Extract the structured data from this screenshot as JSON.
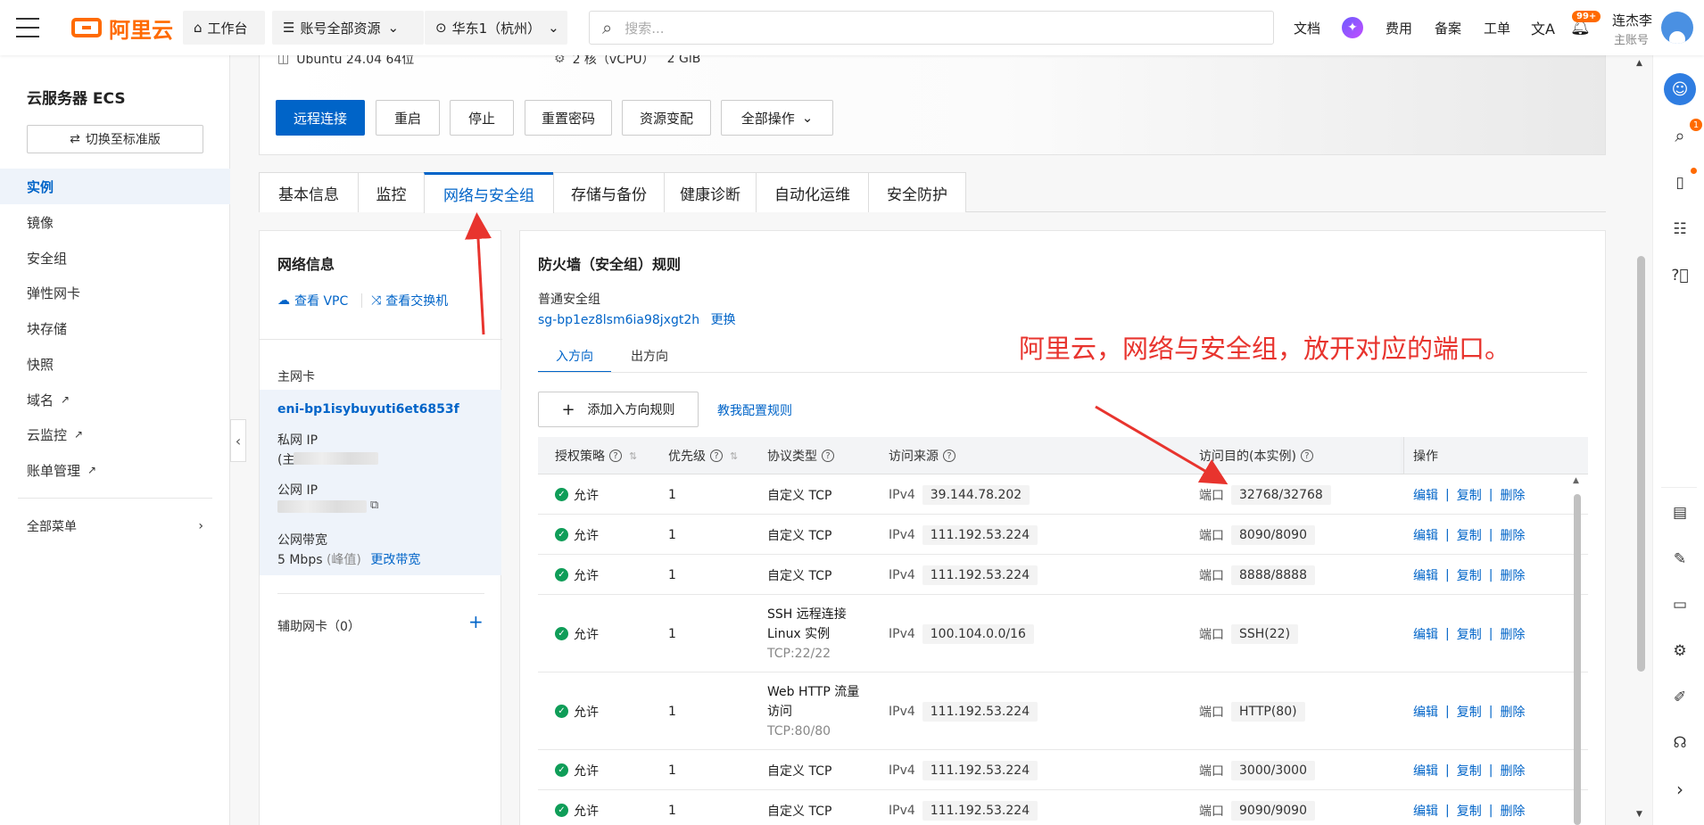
{
  "topbar": {
    "logo_text": "阿里云",
    "workbench": "工作台",
    "resources": "账号全部资源",
    "region": "华东1（杭州）",
    "search_placeholder": "搜索...",
    "docs": "文档",
    "billing": "费用",
    "icp": "备案",
    "ticket": "工单",
    "notif_badge": "99+",
    "user_name": "连杰李",
    "user_role": "主账号"
  },
  "sidebar": {
    "title": "云服务器 ECS",
    "switch_btn": "切换至标准版",
    "items": [
      {
        "label": "实例"
      },
      {
        "label": "镜像"
      },
      {
        "label": "安全组"
      },
      {
        "label": "弹性网卡"
      },
      {
        "label": "块存储"
      },
      {
        "label": "快照"
      },
      {
        "label": "域名"
      },
      {
        "label": "云监控"
      },
      {
        "label": "账单管理"
      }
    ],
    "all_menu": "全部菜单"
  },
  "instance": {
    "os": "Ubuntu 24.04 64位",
    "spec_cpu": "2 核（vCPU）",
    "spec_mem": "2 GiB",
    "buttons": {
      "remote": "远程连接",
      "restart": "重启",
      "stop": "停止",
      "reset_pwd": "重置密码",
      "resize": "资源变配",
      "all_ops": "全部操作"
    }
  },
  "tabs": [
    "基本信息",
    "监控",
    "网络与安全组",
    "存储与备份",
    "健康诊断",
    "自动化运维",
    "安全防护"
  ],
  "network": {
    "title": "网络信息",
    "view_vpc": "查看 VPC",
    "view_switch": "查看交换机",
    "primary_nic_label": "主网卡",
    "nic_id": "eni-bp1isybuyuti6et6853f",
    "private_ip_label": "私网 IP",
    "private_ip_prefix": "(主",
    "public_ip_label": "公网 IP",
    "bandwidth_label": "公网带宽",
    "bandwidth_value": "5 Mbps",
    "bandwidth_note": "(峰值)",
    "change_bandwidth": "更改带宽",
    "secondary_nic": "辅助网卡（0）"
  },
  "firewall": {
    "title": "防火墙（安全组）规则",
    "group_type": "普通安全组",
    "group_id": "sg-bp1ez8lsm6ia98jxgt2h",
    "change": "更换",
    "dir_in": "入方向",
    "dir_out": "出方向",
    "add_rule": "添加入方向规则",
    "teach": "教我配置规则",
    "annotation": "阿里云，网络与安全组，放开对应的端口。",
    "headers": {
      "policy": "授权策略",
      "priority": "优先级",
      "protocol": "协议类型",
      "source": "访问来源",
      "dest": "访问目的(本实例)",
      "ops": "操作"
    },
    "rows": [
      {
        "policy": "允许",
        "priority": "1",
        "protocol": "自定义 TCP",
        "protocol2": "",
        "protocol3": "",
        "ipver": "IPv4",
        "source": "39.144.78.202",
        "port_label": "端口",
        "port": "32768/32768"
      },
      {
        "policy": "允许",
        "priority": "1",
        "protocol": "自定义 TCP",
        "protocol2": "",
        "protocol3": "",
        "ipver": "IPv4",
        "source": "111.192.53.224",
        "port_label": "端口",
        "port": "8090/8090"
      },
      {
        "policy": "允许",
        "priority": "1",
        "protocol": "自定义 TCP",
        "protocol2": "",
        "protocol3": "",
        "ipver": "IPv4",
        "source": "111.192.53.224",
        "port_label": "端口",
        "port": "8888/8888"
      },
      {
        "policy": "允许",
        "priority": "1",
        "protocol": "SSH 远程连接",
        "protocol2": "Linux 实例",
        "protocol3": "TCP:22/22",
        "ipver": "IPv4",
        "source": "100.104.0.0/16",
        "port_label": "端口",
        "port": "SSH(22)"
      },
      {
        "policy": "允许",
        "priority": "1",
        "protocol": "Web HTTP 流量",
        "protocol2": "访问",
        "protocol3": "TCP:80/80",
        "ipver": "IPv4",
        "source": "111.192.53.224",
        "port_label": "端口",
        "port": "HTTP(80)"
      },
      {
        "policy": "允许",
        "priority": "1",
        "protocol": "自定义 TCP",
        "protocol2": "",
        "protocol3": "",
        "ipver": "IPv4",
        "source": "111.192.53.224",
        "port_label": "端口",
        "port": "3000/3000"
      },
      {
        "policy": "允许",
        "priority": "1",
        "protocol": "自定义 TCP",
        "protocol2": "",
        "protocol3": "",
        "ipver": "IPv4",
        "source": "111.192.53.224",
        "port_label": "端口",
        "port": "9090/9090"
      }
    ],
    "ops": {
      "edit": "编辑",
      "copy": "复制",
      "delete": "删除"
    }
  },
  "colors": {
    "accent": "#0064c8",
    "brand": "#ff6a00",
    "annotation": "#e8342e",
    "success": "#0f9d58"
  }
}
